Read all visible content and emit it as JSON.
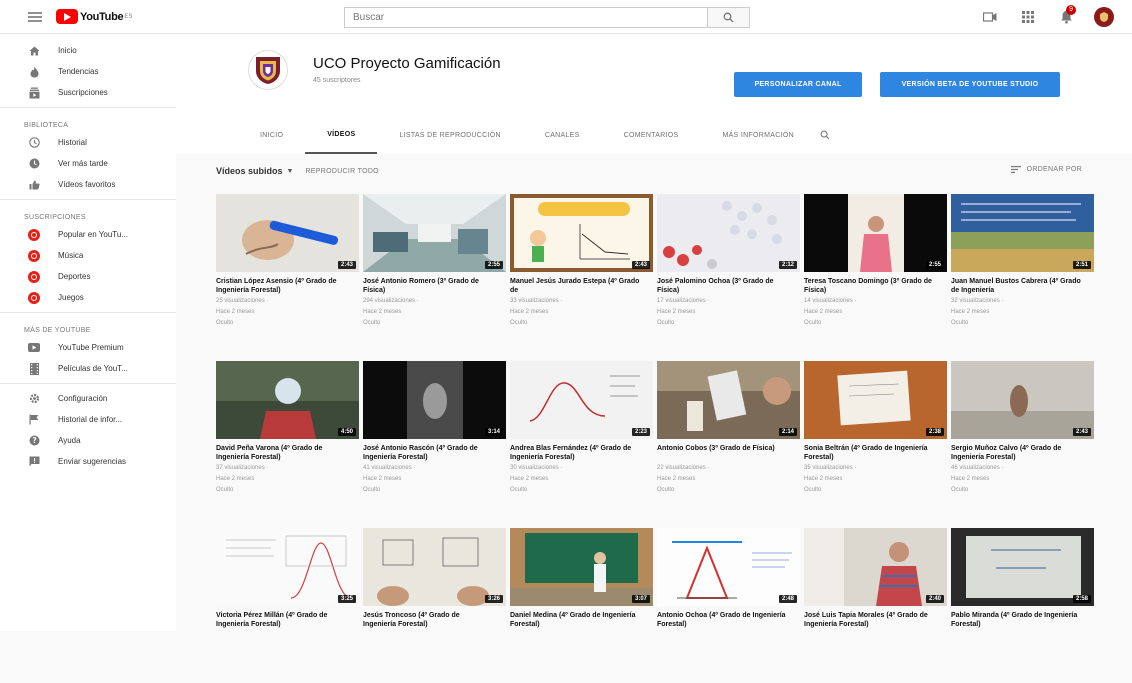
{
  "topbar": {
    "logo_text": "YouTube",
    "logo_sup": "ES",
    "search_placeholder": "Buscar",
    "notifications_count": "9"
  },
  "sidebar": {
    "main": [
      {
        "label": "Inicio",
        "icon": "home-icon"
      },
      {
        "label": "Tendencias",
        "icon": "trending-icon"
      },
      {
        "label": "Suscripciones",
        "icon": "subscriptions-icon"
      }
    ],
    "library_title": "BIBLIOTECA",
    "library": [
      {
        "label": "Historial",
        "icon": "history-icon"
      },
      {
        "label": "Ver más tarde",
        "icon": "clock-icon"
      },
      {
        "label": "Vídeos favoritos",
        "icon": "thumbs-up-icon"
      }
    ],
    "subs_title": "SUSCRIPCIONES",
    "subs": [
      {
        "label": "Popular en YouTu..."
      },
      {
        "label": "Música"
      },
      {
        "label": "Deportes"
      },
      {
        "label": "Juegos"
      }
    ],
    "more_title": "MÁS DE YOUTUBE",
    "more": [
      {
        "label": "YouTube Premium",
        "icon": "youtube-premium-icon"
      },
      {
        "label": "Películas de YouT...",
        "icon": "film-icon"
      }
    ],
    "bottom": [
      {
        "label": "Configuración",
        "icon": "gear-icon"
      },
      {
        "label": "Historial de infor...",
        "icon": "flag-icon"
      },
      {
        "label": "Ayuda",
        "icon": "help-icon"
      },
      {
        "label": "Enviar sugerencias",
        "icon": "feedback-icon"
      }
    ]
  },
  "channel": {
    "name": "UCO Proyecto Gamificación",
    "subscribers": "45 suscriptores",
    "customize_button": "PERSONALIZAR CANAL",
    "studio_button": "VERSIÓN BETA DE YOUTUBE STUDIO",
    "tabs": [
      "INICIO",
      "VÍDEOS",
      "LISTAS DE REPRODUCCIÓN",
      "CANALES",
      "COMENTARIOS",
      "MÁS INFORMACIÓN"
    ],
    "active_tab": "VÍDEOS"
  },
  "uploads": {
    "title": "Vídeos subidos",
    "play_all": "REPRODUCIR TODO",
    "sort_by": "ORDENAR POR"
  },
  "videos": [
    {
      "title": "Cristian López Asensio (4º Grado de Ingeniería Forestal)",
      "views": "25 visualizaciones",
      "age": "Hace 2 meses",
      "status": "Oculto",
      "duration": "2:43"
    },
    {
      "title": "José Antonio Romero (3º Grado de Física)",
      "views": "294 visualizaciones",
      "age": "Hace 2 meses",
      "status": "Oculto",
      "duration": "2:55"
    },
    {
      "title": "Manuel Jesús Jurado Estepa (4º Grado de",
      "views": "33 visualizaciones",
      "age": "Hace 2 meses",
      "status": "Oculto",
      "duration": "2:43"
    },
    {
      "title": "José Palomino Ochoa (3º Grado de Física)",
      "views": "17 visualizaciones",
      "age": "Hace 2 meses",
      "status": "Oculto",
      "duration": "2:12"
    },
    {
      "title": "Teresa Toscano Domingo (3º Grado de Física)",
      "views": "14 visualizaciones",
      "age": "Hace 2 meses",
      "status": "Oculto",
      "duration": "2:55"
    },
    {
      "title": "Juan Manuel Bustos Cabrera (4º Grado de Ingeniería",
      "views": "32 visualizaciones",
      "age": "Hace 2 meses",
      "status": "Oculto",
      "duration": "2:51"
    },
    {
      "title": "David Peña Varona (4º Grado de Ingeniería Forestal)",
      "views": "37 visualizaciones",
      "age": "Hace 2 meses",
      "status": "Oculto",
      "duration": "4:50"
    },
    {
      "title": "José Antonio Rascón (4º Grado de Ingeniería Forestal)",
      "views": "41 visualizaciones",
      "age": "Hace 2 meses",
      "status": "Oculto",
      "duration": "3:14"
    },
    {
      "title": "Andrea Blas Fernández (4º Grado de Ingeniería Forestal)",
      "views": "30 visualizaciones",
      "age": "Hace 2 meses",
      "status": "Oculto",
      "duration": "2:23"
    },
    {
      "title": "Antonio Cobos (3º Grado de Física)",
      "views": "22 visualizaciones",
      "age": "Hace 2 meses",
      "status": "Oculto",
      "duration": "2:14"
    },
    {
      "title": "Sonia Beltrán (4º Grado de Ingeniería Forestal)",
      "views": "35 visualizaciones",
      "age": "Hace 2 meses",
      "status": "Oculto",
      "duration": "2:38"
    },
    {
      "title": "Sergio Muñoz Calvo (4º Grado de Ingeniería Forestal)",
      "views": "46 visualizaciones",
      "age": "Hace 2 meses",
      "status": "Oculto",
      "duration": "2:43"
    },
    {
      "title": "Victoria Pérez Millán (4º Grado de Ingeniería Forestal)",
      "views": "",
      "age": "",
      "status": "",
      "duration": "3:25"
    },
    {
      "title": "Jesús Troncoso (4º Grado de Ingeniería Forestal)",
      "views": "",
      "age": "",
      "status": "",
      "duration": "3:26"
    },
    {
      "title": "Daniel Medina (4º Grado de Ingeniería Forestal)",
      "views": "",
      "age": "",
      "status": "",
      "duration": "3:07"
    },
    {
      "title": "Antonio Ochoa (4º Grado de Ingeniería Forestal)",
      "views": "",
      "age": "",
      "status": "",
      "duration": "2:48"
    },
    {
      "title": "José Luis Tapia Morales (4º Grado de Ingeniería Forestal)",
      "views": "",
      "age": "",
      "status": "",
      "duration": "2:40"
    },
    {
      "title": "Pablo Miranda (4º Grado de Ingeniería Forestal)",
      "views": "",
      "age": "",
      "status": "",
      "duration": "2:58"
    }
  ],
  "colors": {
    "accent_blue": "#2e86e0",
    "brand_red": "#ff0000"
  }
}
